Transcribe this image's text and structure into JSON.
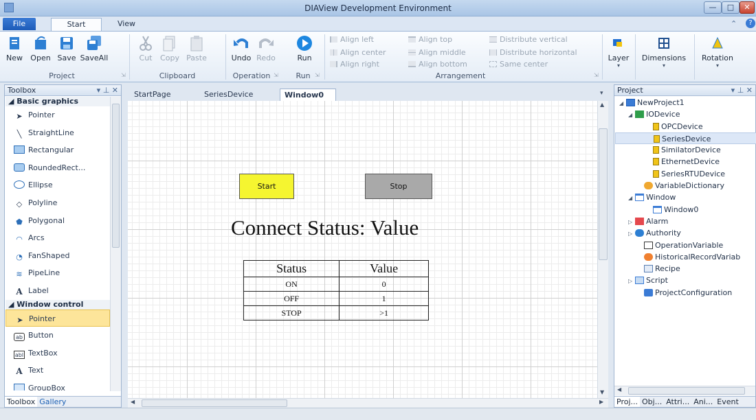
{
  "window": {
    "title": "DIAView Development Environment",
    "min": "—",
    "max": "□",
    "close": "✕"
  },
  "menu": {
    "file": "File",
    "tabs": [
      "Start",
      "View"
    ]
  },
  "ribbon": {
    "buttons": {
      "new": "New",
      "open": "Open",
      "save": "Save",
      "saveall": "SaveAll",
      "cut": "Cut",
      "copy": "Copy",
      "paste": "Paste",
      "undo": "Undo",
      "redo": "Redo",
      "run": "Run",
      "layer": "Layer",
      "dimensions": "Dimensions",
      "rotation": "Rotation"
    },
    "arrangement": {
      "align_left": "Align left",
      "align_center": "Align center",
      "align_right": "Align right",
      "align_top": "Align top",
      "align_middle": "Align middle",
      "align_bottom": "Align bottom",
      "distribute_vertical": "Distribute vertical",
      "distribute_horizontal": "Distribute horizontal",
      "same_center": "Same center"
    },
    "groups": {
      "project": "Project",
      "clipboard": "Clipboard",
      "operation": "Operation",
      "run": "Run",
      "arrangement": "Arrangement"
    }
  },
  "toolbox": {
    "title": "Toolbox",
    "pins": "▾ ⊥ ✕",
    "section_basic": "Basic graphics",
    "basic_items": [
      "Pointer",
      "StraightLine",
      "Rectangular",
      "RoundedRect...",
      "Ellipse",
      "Polyline",
      "Polygonal",
      "Arcs",
      "FanShaped",
      "PipeLine",
      "Label"
    ],
    "section_window": "Window control",
    "window_items": [
      "Pointer",
      "Button",
      "TextBox",
      "Text",
      "GroupBox"
    ],
    "bottom_tabs": [
      "Toolbox",
      "Gallery"
    ]
  },
  "doc": {
    "tabs": [
      "StartPage",
      "SeriesDevice",
      "Window0"
    ],
    "close": "×"
  },
  "canvas": {
    "start_button": "Start",
    "stop_button": "Stop",
    "status_text": "Connect Status: Value",
    "table": {
      "headers": [
        "Status",
        "Value"
      ],
      "rows": [
        [
          "ON",
          "0"
        ],
        [
          "OFF",
          "1"
        ],
        [
          "STOP",
          ">1"
        ]
      ]
    },
    "start_color": "#f5f530",
    "stop_color": "#a9a9a9"
  },
  "project": {
    "title": "Project",
    "pins": "▾ ⊥ ✕",
    "nodes": [
      {
        "label": "NewProject1",
        "indent": 0,
        "toggle": "◢",
        "icon": "project-icon"
      },
      {
        "label": "IODevice",
        "indent": 1,
        "toggle": "◢",
        "icon": "network-icon"
      },
      {
        "label": "OPCDevice",
        "indent": 3,
        "toggle": "",
        "icon": "device-icon"
      },
      {
        "label": "SeriesDevice",
        "indent": 3,
        "toggle": "",
        "icon": "device-icon",
        "selected": true
      },
      {
        "label": "SimilatorDevice",
        "indent": 3,
        "toggle": "",
        "icon": "device-icon"
      },
      {
        "label": "EthernetDevice",
        "indent": 3,
        "toggle": "",
        "icon": "device-icon"
      },
      {
        "label": "SeriesRTUDevice",
        "indent": 3,
        "toggle": "",
        "icon": "device-icon"
      },
      {
        "label": "VariableDictionary",
        "indent": 2,
        "toggle": "",
        "icon": "dictionary-icon"
      },
      {
        "label": "Window",
        "indent": 1,
        "toggle": "◢",
        "icon": "window-icon"
      },
      {
        "label": "Window0",
        "indent": 3,
        "toggle": "",
        "icon": "window-icon"
      },
      {
        "label": "Alarm",
        "indent": 1,
        "toggle": "▷",
        "icon": "alarm-icon"
      },
      {
        "label": "Authority",
        "indent": 1,
        "toggle": "▷",
        "icon": "users-icon"
      },
      {
        "label": "OperationVariable",
        "indent": 2,
        "toggle": "",
        "icon": "chart-icon"
      },
      {
        "label": "HistoricalRecordVariab",
        "indent": 2,
        "toggle": "",
        "icon": "history-icon"
      },
      {
        "label": "Recipe",
        "indent": 2,
        "toggle": "",
        "icon": "recipe-icon"
      },
      {
        "label": "Script",
        "indent": 1,
        "toggle": "▷",
        "icon": "script-icon"
      },
      {
        "label": "ProjectConfiguration",
        "indent": 2,
        "toggle": "",
        "icon": "wrench-icon"
      }
    ],
    "bottom_tabs": [
      "Proj...",
      "Obj...",
      "Attri...",
      "Ani...",
      "Event"
    ]
  }
}
